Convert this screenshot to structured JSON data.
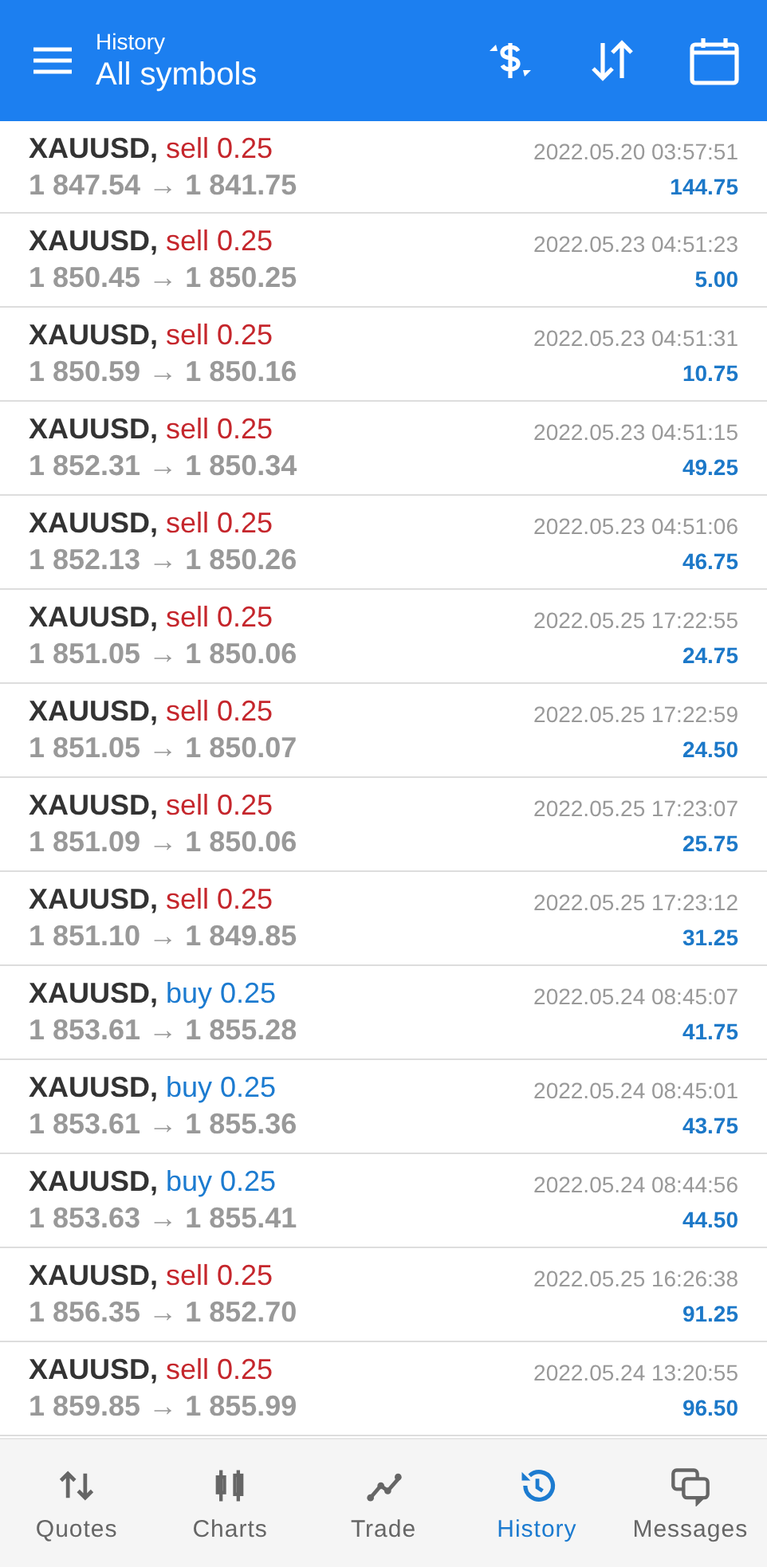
{
  "header": {
    "subtitle": "History",
    "title": "All symbols"
  },
  "deals": [
    {
      "symbol": "XAUUSD,",
      "kind": "sell",
      "action": "sell 0.25",
      "prices": "1 847.54 → 1 841.75",
      "time": "2022.05.20 03:57:51",
      "profit": "144.75"
    },
    {
      "symbol": "XAUUSD,",
      "kind": "sell",
      "action": "sell 0.25",
      "prices": "1 850.45 → 1 850.25",
      "time": "2022.05.23 04:51:23",
      "profit": "5.00"
    },
    {
      "symbol": "XAUUSD,",
      "kind": "sell",
      "action": "sell 0.25",
      "prices": "1 850.59 → 1 850.16",
      "time": "2022.05.23 04:51:31",
      "profit": "10.75"
    },
    {
      "symbol": "XAUUSD,",
      "kind": "sell",
      "action": "sell 0.25",
      "prices": "1 852.31 → 1 850.34",
      "time": "2022.05.23 04:51:15",
      "profit": "49.25"
    },
    {
      "symbol": "XAUUSD,",
      "kind": "sell",
      "action": "sell 0.25",
      "prices": "1 852.13 → 1 850.26",
      "time": "2022.05.23 04:51:06",
      "profit": "46.75"
    },
    {
      "symbol": "XAUUSD,",
      "kind": "sell",
      "action": "sell 0.25",
      "prices": "1 851.05 → 1 850.06",
      "time": "2022.05.25 17:22:55",
      "profit": "24.75"
    },
    {
      "symbol": "XAUUSD,",
      "kind": "sell",
      "action": "sell 0.25",
      "prices": "1 851.05 → 1 850.07",
      "time": "2022.05.25 17:22:59",
      "profit": "24.50"
    },
    {
      "symbol": "XAUUSD,",
      "kind": "sell",
      "action": "sell 0.25",
      "prices": "1 851.09 → 1 850.06",
      "time": "2022.05.25 17:23:07",
      "profit": "25.75"
    },
    {
      "symbol": "XAUUSD,",
      "kind": "sell",
      "action": "sell 0.25",
      "prices": "1 851.10 → 1 849.85",
      "time": "2022.05.25 17:23:12",
      "profit": "31.25"
    },
    {
      "symbol": "XAUUSD,",
      "kind": "buy",
      "action": "buy 0.25",
      "prices": "1 853.61 → 1 855.28",
      "time": "2022.05.24 08:45:07",
      "profit": "41.75"
    },
    {
      "symbol": "XAUUSD,",
      "kind": "buy",
      "action": "buy 0.25",
      "prices": "1 853.61 → 1 855.36",
      "time": "2022.05.24 08:45:01",
      "profit": "43.75"
    },
    {
      "symbol": "XAUUSD,",
      "kind": "buy",
      "action": "buy 0.25",
      "prices": "1 853.63 → 1 855.41",
      "time": "2022.05.24 08:44:56",
      "profit": "44.50"
    },
    {
      "symbol": "XAUUSD,",
      "kind": "sell",
      "action": "sell 0.25",
      "prices": "1 856.35 → 1 852.70",
      "time": "2022.05.25 16:26:38",
      "profit": "91.25"
    },
    {
      "symbol": "XAUUSD,",
      "kind": "sell",
      "action": "sell 0.25",
      "prices": "1 859.85 → 1 855.99",
      "time": "2022.05.24 13:20:55",
      "profit": "96.50"
    }
  ],
  "nav": [
    {
      "label": "Quotes",
      "kind": "quotes",
      "selected": false
    },
    {
      "label": "Charts",
      "kind": "charts",
      "selected": false
    },
    {
      "label": "Trade",
      "kind": "trade",
      "selected": false
    },
    {
      "label": "History",
      "kind": "history",
      "selected": true
    },
    {
      "label": "Messages",
      "kind": "messages",
      "selected": false
    }
  ]
}
